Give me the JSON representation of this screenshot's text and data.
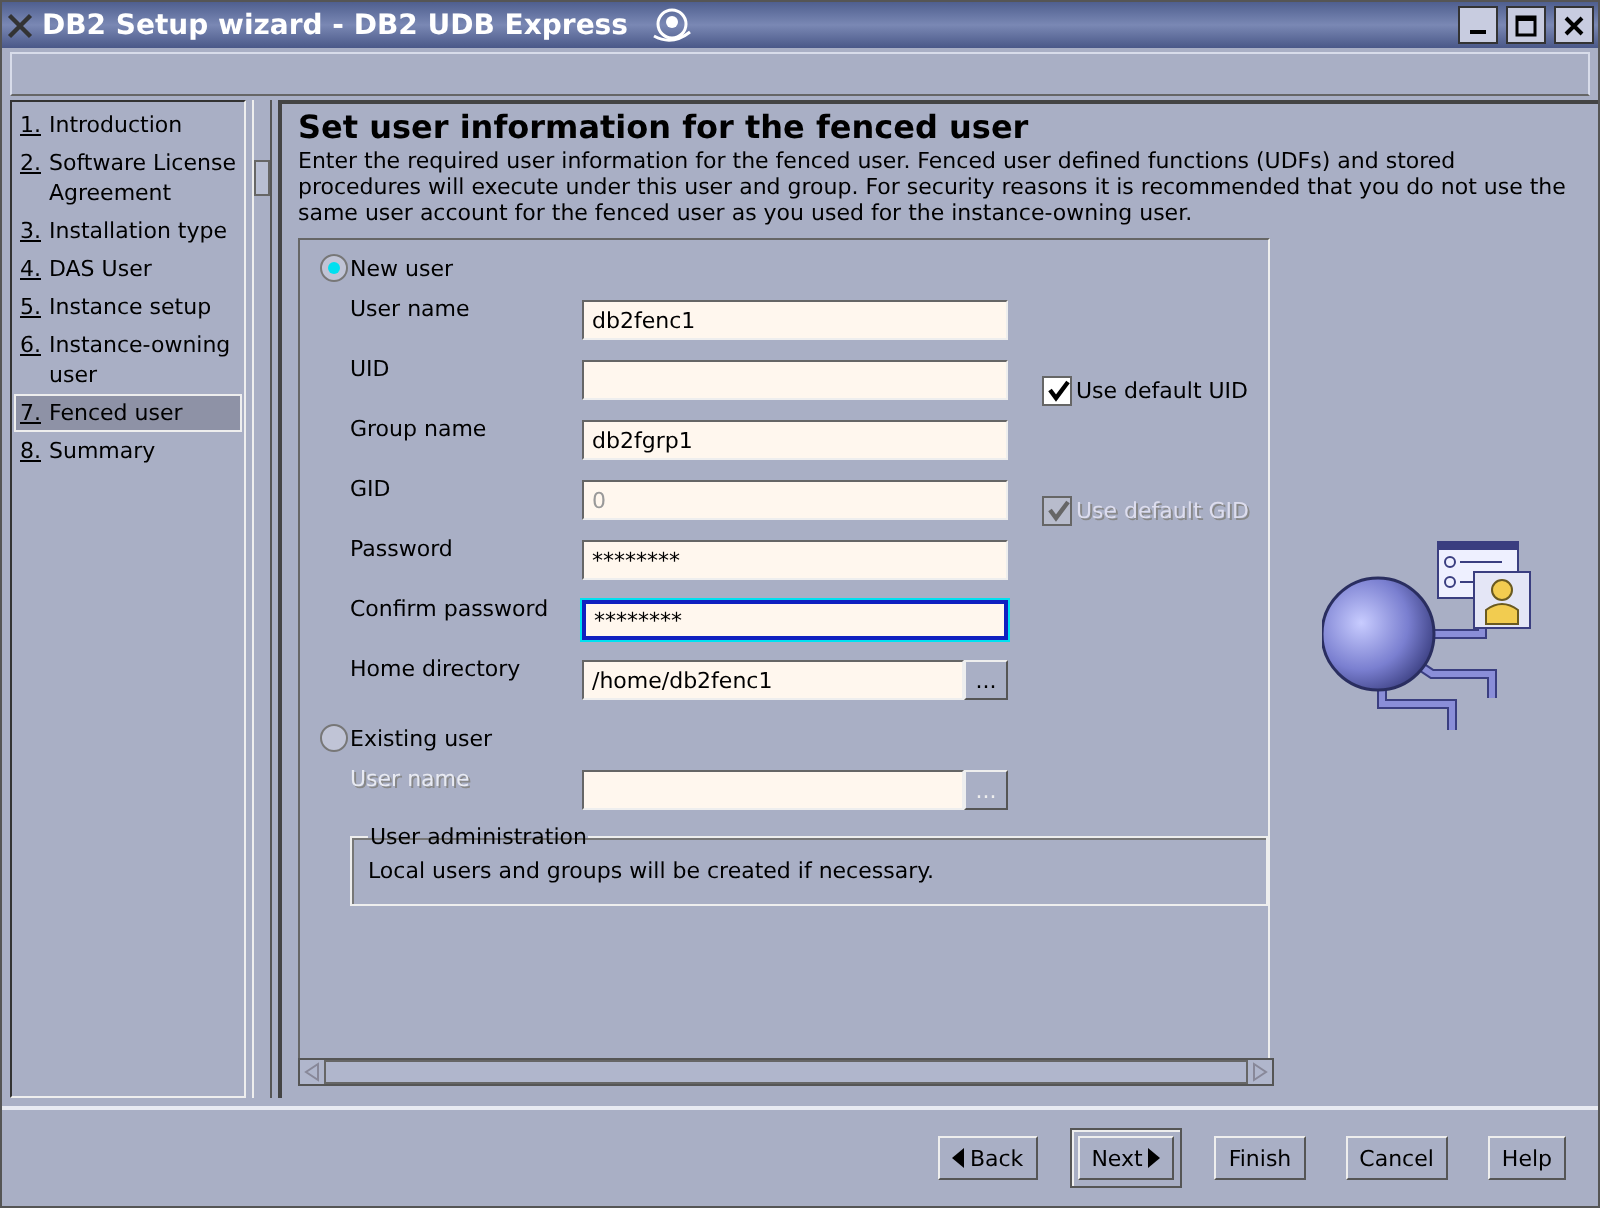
{
  "window": {
    "title": "DB2 Setup wizard - DB2 UDB Express"
  },
  "steps": [
    {
      "number": "1.",
      "label": "Introduction",
      "selected": false
    },
    {
      "number": "2.",
      "label": "Software License Agreement",
      "selected": false
    },
    {
      "number": "3.",
      "label": "Installation type",
      "selected": false
    },
    {
      "number": "4.",
      "label": "DAS User",
      "selected": false
    },
    {
      "number": "5.",
      "label": "Instance setup",
      "selected": false
    },
    {
      "number": "6.",
      "label": "Instance-owning user",
      "selected": false
    },
    {
      "number": "7.",
      "label": "Fenced user",
      "selected": true
    },
    {
      "number": "8.",
      "label": "Summary",
      "selected": false
    }
  ],
  "heading": "Set user information for the fenced user",
  "description": "Enter the required user information for the fenced user.  Fenced user defined functions (UDFs) and stored procedures will execute under this user and group.  For security reasons it is recommended that you do not use the same user account for the fenced user as you used for the instance-owning user.",
  "new_user": {
    "label": "New user",
    "selected": true,
    "fields": [
      {
        "label": "User name",
        "value": "db2fenc1",
        "disabled": false,
        "focused": false
      },
      {
        "label": "UID",
        "disabled": false,
        "focused": false,
        "checkbox": {
          "label": "Use default UID",
          "checked": true,
          "disabled": false
        }
      },
      {
        "label": "Group name",
        "value": "db2fgrp1",
        "disabled": false,
        "focused": false
      },
      {
        "label": "GID",
        "value": "0",
        "disabled": true,
        "focused": false,
        "checkbox": {
          "label": "Use default GID",
          "checked": true,
          "disabled": true
        }
      },
      {
        "label": "Password",
        "value": "********",
        "disabled": false,
        "focused": false
      },
      {
        "label": "Confirm password",
        "value": "********",
        "disabled": false,
        "focused": true
      },
      {
        "label": "Home directory",
        "value": "/home/db2fenc1",
        "disabled": false,
        "focused": false,
        "button": "..."
      }
    ]
  },
  "existing_user": {
    "label": "Existing user",
    "selected": false,
    "fields": [
      {
        "label": "User name",
        "disabled": true,
        "focused": false,
        "button": "..."
      }
    ]
  },
  "user_administration": {
    "title": "User administration",
    "text": "Local users and groups will be created if necessary."
  },
  "buttons": [
    {
      "label": "Back",
      "kind": "back",
      "default": false
    },
    {
      "label": "Next",
      "kind": "next",
      "default": true
    },
    {
      "label": "Finish",
      "default": false
    },
    {
      "label": "Cancel",
      "default": false
    },
    {
      "label": "Help",
      "default": false
    }
  ]
}
